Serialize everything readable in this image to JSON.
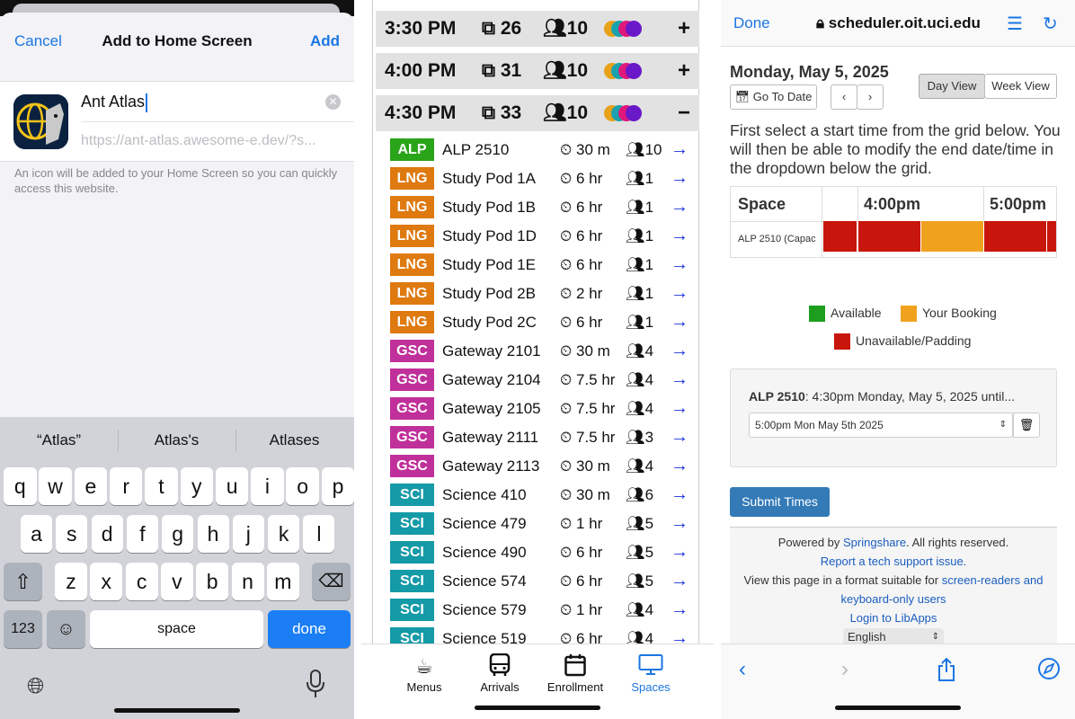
{
  "add_home": {
    "cancel": "Cancel",
    "title": "Add to Home Screen",
    "add": "Add",
    "app_name": "Ant Atlas",
    "url": "https://ant-atlas.awesome-e.dev/?s...",
    "description": "An icon will be added to your Home Screen so you can quickly access this website.",
    "suggestions": [
      "“Atlas”",
      "Atlas's",
      "Atlases"
    ],
    "row1": [
      "q",
      "w",
      "e",
      "r",
      "t",
      "y",
      "u",
      "i",
      "o",
      "p"
    ],
    "row2": [
      "a",
      "s",
      "d",
      "f",
      "g",
      "h",
      "j",
      "k",
      "l"
    ],
    "row3": [
      "z",
      "x",
      "c",
      "v",
      "b",
      "n",
      "m"
    ],
    "num_key": "123",
    "space": "space",
    "done": "done"
  },
  "spaces": {
    "slots": [
      {
        "time": "3:30 PM",
        "rooms": "26",
        "people": "10",
        "toggle": "+"
      },
      {
        "time": "4:00 PM",
        "rooms": "31",
        "people": "10",
        "toggle": "+"
      },
      {
        "time": "4:30 PM",
        "rooms": "33",
        "people": "10",
        "toggle": "−"
      }
    ],
    "dot_colors": [
      "#e8a21a",
      "#19a2ad",
      "#e0187a",
      "#6a19c9"
    ],
    "rows": [
      {
        "code": "ALP",
        "color": "#2aa419",
        "name": "ALP 2510",
        "duration": "30 m",
        "capacity": "10"
      },
      {
        "code": "LNG",
        "color": "#de7a0f",
        "name": "Study Pod 1A",
        "duration": "6 hr",
        "capacity": "1"
      },
      {
        "code": "LNG",
        "color": "#de7a0f",
        "name": "Study Pod 1B",
        "duration": "6 hr",
        "capacity": "1"
      },
      {
        "code": "LNG",
        "color": "#de7a0f",
        "name": "Study Pod 1D",
        "duration": "6 hr",
        "capacity": "1"
      },
      {
        "code": "LNG",
        "color": "#de7a0f",
        "name": "Study Pod 1E",
        "duration": "6 hr",
        "capacity": "1"
      },
      {
        "code": "LNG",
        "color": "#de7a0f",
        "name": "Study Pod 2B",
        "duration": "2 hr",
        "capacity": "1"
      },
      {
        "code": "LNG",
        "color": "#de7a0f",
        "name": "Study Pod 2C",
        "duration": "6 hr",
        "capacity": "1"
      },
      {
        "code": "GSC",
        "color": "#c0309a",
        "name": "Gateway 2101",
        "duration": "30 m",
        "capacity": "4"
      },
      {
        "code": "GSC",
        "color": "#c0309a",
        "name": "Gateway 2104",
        "duration": "7.5 hr",
        "capacity": "4"
      },
      {
        "code": "GSC",
        "color": "#c0309a",
        "name": "Gateway 2105",
        "duration": "7.5 hr",
        "capacity": "4"
      },
      {
        "code": "GSC",
        "color": "#c0309a",
        "name": "Gateway 2111",
        "duration": "7.5 hr",
        "capacity": "3"
      },
      {
        "code": "GSC",
        "color": "#c0309a",
        "name": "Gateway 2113",
        "duration": "30 m",
        "capacity": "4"
      },
      {
        "code": "SCI",
        "color": "#159aa7",
        "name": "Science 410",
        "duration": "30 m",
        "capacity": "6"
      },
      {
        "code": "SCI",
        "color": "#159aa7",
        "name": "Science 479",
        "duration": "1 hr",
        "capacity": "5"
      },
      {
        "code": "SCI",
        "color": "#159aa7",
        "name": "Science 490",
        "duration": "6 hr",
        "capacity": "5"
      },
      {
        "code": "SCI",
        "color": "#159aa7",
        "name": "Science 574",
        "duration": "6 hr",
        "capacity": "5"
      },
      {
        "code": "SCI",
        "color": "#159aa7",
        "name": "Science 579",
        "duration": "1 hr",
        "capacity": "4"
      },
      {
        "code": "SCI",
        "color": "#159aa7",
        "name": "Science 519",
        "duration": "6 hr",
        "capacity": "4"
      }
    ],
    "tabs": [
      {
        "label": "Menus",
        "icon": "coffee-cup-icon"
      },
      {
        "label": "Arrivals",
        "icon": "bus-icon"
      },
      {
        "label": "Enrollment",
        "icon": "calendar-icon"
      },
      {
        "label": "Spaces",
        "icon": "monitor-icon",
        "active": true
      }
    ]
  },
  "scheduler": {
    "done": "Done",
    "domain": "scheduler.oit.uci.edu",
    "date": "Monday, May 5, 2025",
    "goto": "Go To Date",
    "day_view": "Day View",
    "week_view": "Week View",
    "instructions": "First select a start time from the grid below. You will then be able to modify the end date/time in the dropdown below the grid.",
    "grid_header_space": "Space",
    "grid_header_4": "4:00pm",
    "grid_header_5": "5:00pm",
    "grid_row_label": "ALP 2510 (Capac",
    "legend_available": "Available",
    "legend_booking": "Your Booking",
    "legend_unavailable": "Unavailable/Padding",
    "color_available": "#1e9e1e",
    "color_booking": "#f0a21f",
    "color_unavailable": "#c8160c",
    "booking_room": "ALP 2510",
    "booking_text": ": 4:30pm Monday, May 5, 2025 until...",
    "end_select": "5:00pm Mon May 5th 2025",
    "submit": "Submit Times",
    "powered_prefix": "Powered by ",
    "powered_link": "Springshare",
    "powered_suffix": ". All rights reserved.",
    "report": "Report a tech support issue.",
    "view_prefix": "View this page in a format suitable for ",
    "view_link": "screen-readers and keyboard-only users",
    "login": "Login to LibApps",
    "language": "English"
  }
}
